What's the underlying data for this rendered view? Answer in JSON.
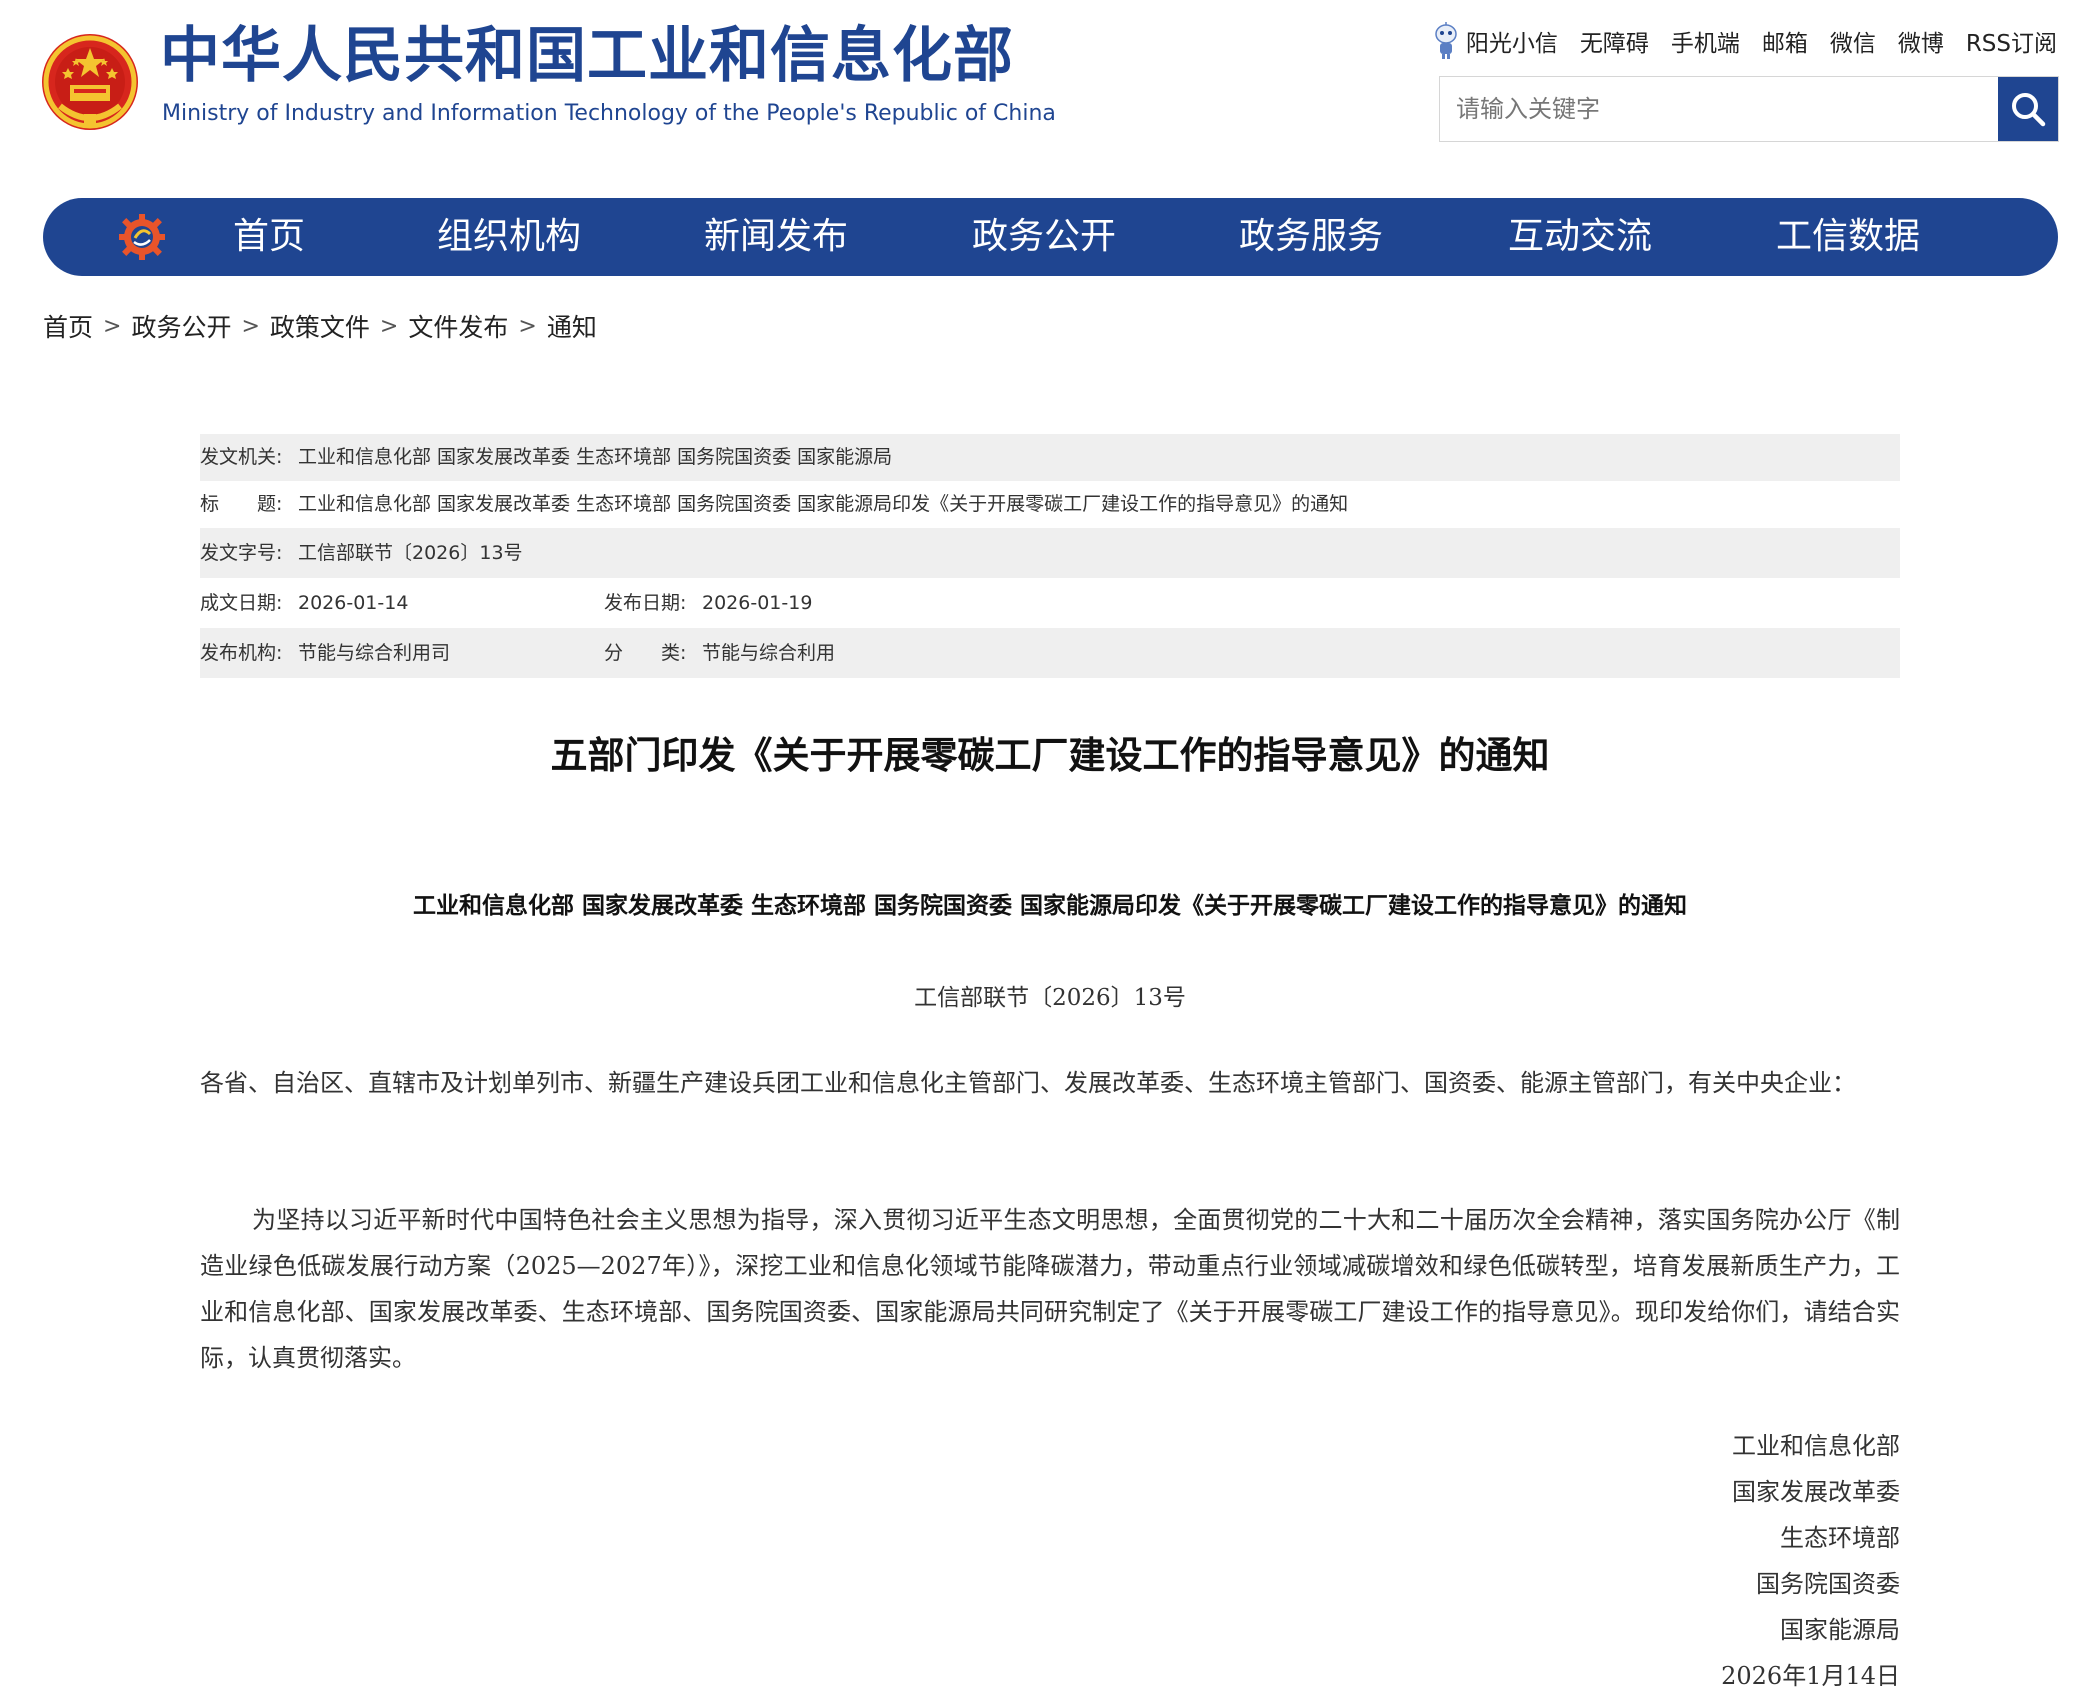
{
  "header": {
    "title": "中华人民共和国工业和信息化部",
    "subtitle": "Ministry of Industry and Information Technology of the People's Republic of China",
    "top_links": [
      "阳光小信",
      "无障碍",
      "手机端",
      "邮箱",
      "微信",
      "微博",
      "RSS订阅"
    ],
    "search_placeholder": "请输入关键字"
  },
  "nav": {
    "items": [
      "首页",
      "组织机构",
      "新闻发布",
      "政务公开",
      "政务服务",
      "互动交流",
      "工信数据"
    ]
  },
  "breadcrumb": [
    "首页",
    "政务公开",
    "政策文件",
    "文件发布",
    "通知"
  ],
  "breadcrumb_separator": ">",
  "info": {
    "issuer_label": "发文机关:",
    "issuer": "工业和信息化部 国家发展改革委 生态环境部 国务院国资委 国家能源局",
    "title_label": "标　　题:",
    "title": "工业和信息化部 国家发展改革委 生态环境部 国务院国资委 国家能源局印发《关于开展零碳工厂建设工作的指导意见》的通知",
    "doc_no_label": "发文字号:",
    "doc_no": "工信部联节〔2026〕13号",
    "written_date_label": "成文日期:",
    "written_date": "2026-01-14",
    "publish_date_label": "发布日期:",
    "publish_date": "2026-01-19",
    "agency_label": "发布机构:",
    "agency": "节能与综合利用司",
    "category_label": "分　　类:",
    "category": "节能与综合利用"
  },
  "article": {
    "title": "五部门印发《关于开展零碳工厂建设工作的指导意见》的通知",
    "doc_heading": "工业和信息化部  国家发展改革委  生态环境部  国务院国资委  国家能源局印发《关于开展零碳工厂建设工作的指导意见》的通知",
    "doc_number": "工信部联节〔2026〕13号",
    "address": "各省、自治区、直辖市及计划单列市、新疆生产建设兵团工业和信息化主管部门、发展改革委、生态环境主管部门、国资委、能源主管部门，有关中央企业：",
    "body": "为坚持以习近平新时代中国特色社会主义思想为指导，深入贯彻习近平生态文明思想，全面贯彻党的二十大和二十届历次全会精神，落实国务院办公厅《制造业绿色低碳发展行动方案（2025—2027年）》，深挖工业和信息化领域节能降碳潜力，带动重点行业领域减碳增效和绿色低碳转型，培育发展新质生产力，工业和信息化部、国家发展改革委、生态环境部、国务院国资委、国家能源局共同研究制定了《关于开展零碳工厂建设工作的指导意见》。现印发给你们，请结合实际，认真贯彻落实。",
    "signatories": [
      "工业和信息化部",
      "国家发展改革委",
      "生态环境部",
      "国务院国资委",
      "国家能源局"
    ],
    "sign_date": "2026年1月14日"
  },
  "colors": {
    "brand_blue": "#1f4591",
    "emblem_red": "#d7261d",
    "emblem_gold": "#f4c430",
    "shaded_row": "#efefef"
  }
}
